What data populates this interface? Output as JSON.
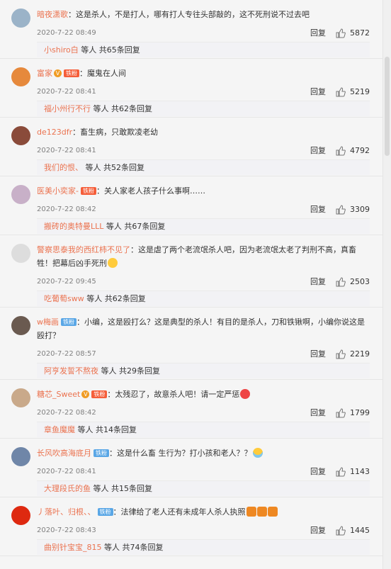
{
  "comments": [
    {
      "user": "暗夜潇歌",
      "badges": [],
      "text": "这是杀人，不是打人，哪有打人专往头部敲的，这不死刑说不过去吧",
      "emoji": "",
      "time": "2020-7-22 08:49",
      "reply": "回复",
      "likes": "5872",
      "sub_user": "小shiro白",
      "sub_more": "等人 共65条回复",
      "avatar_color": "#9bb3c8"
    },
    {
      "user": "富家",
      "badges": [
        {
          "kind": "v",
          "text": "V"
        },
        {
          "kind": "mem",
          "text": "铁粉"
        }
      ],
      "text": "魔鬼在人间",
      "emoji": "",
      "time": "2020-7-22 08:41",
      "reply": "回复",
      "likes": "5219",
      "sub_user": "福小州行不行",
      "sub_more": "等人 共62条回复",
      "avatar_color": "#e6893c"
    },
    {
      "user": "de123dfr",
      "badges": [],
      "text": "畜生病，只敢欺凌老幼",
      "emoji": "",
      "time": "2020-7-22 08:41",
      "reply": "回复",
      "likes": "4792",
      "sub_user": "我们的恨、",
      "sub_more": "等人 共52条回复",
      "avatar_color": "#8a4b3a"
    },
    {
      "user": "医美小奕家-",
      "badges": [
        {
          "kind": "mem",
          "text": "铁粉"
        }
      ],
      "text": "关人家老人孩子什么事啊……",
      "emoji": "",
      "time": "2020-7-22 08:42",
      "reply": "回复",
      "likes": "3309",
      "sub_user": "搬砖的奥特曼LLL",
      "sub_more": "等人 共67条回复",
      "avatar_color": "#c8b0c8"
    },
    {
      "user": "警察思泰我的西红柿不见了",
      "badges": [],
      "text": "这是虐了两个老流氓杀人吧，因为老流氓太老了判刑不高，真畜牲！把幕后凶手死刑",
      "emoji": "smile",
      "time": "2020-7-22 09:45",
      "reply": "回复",
      "likes": "2503",
      "sub_user": "吃葡萄sww",
      "sub_more": "等人 共62条回复",
      "avatar_color": "#dddddd",
      "tall": true
    },
    {
      "user": "w梅画",
      "badges": [
        {
          "kind": "fan",
          "text": "铁粉"
        }
      ],
      "text": "小编，这是殴打么？这是典型的杀人！有目的是杀人，刀和铁锹啊，小编你说这是殴打？",
      "emoji": "",
      "time": "2020-7-22 08:57",
      "reply": "回复",
      "likes": "2219",
      "sub_user": "阿亨发誓不熬夜",
      "sub_more": "等人 共29条回复",
      "avatar_color": "#6a5a50",
      "tall": true
    },
    {
      "user": "糖芯_Sweet",
      "badges": [
        {
          "kind": "v",
          "text": "V"
        },
        {
          "kind": "mem",
          "text": "铁粉"
        }
      ],
      "text": "太残忍了，故意杀人吧！请一定严惩",
      "emoji": "angry",
      "time": "2020-7-22 08:42",
      "reply": "回复",
      "likes": "1799",
      "sub_user": "章鱼魔魔",
      "sub_more": "等人 共14条回复",
      "avatar_color": "#c9a98a"
    },
    {
      "user": "长风吹高海底月",
      "badges": [
        {
          "kind": "fan",
          "text": "铁粉"
        }
      ],
      "text": "这是什么畜 生行为？打小孩和老人？？",
      "emoji": "cry",
      "time": "2020-7-22 08:41",
      "reply": "回复",
      "likes": "1143",
      "sub_user": "大理段氏的鱼",
      "sub_more": "等人 共15条回复",
      "avatar_color": "#6f86a8"
    },
    {
      "user": "丿落叶、归根、、",
      "badges": [
        {
          "kind": "fan",
          "text": "铁粉"
        }
      ],
      "text": "法律给了老人还有未成年人杀人执照",
      "emoji": "candle",
      "emoji_count": 3,
      "time": "2020-7-22 08:43",
      "reply": "回复",
      "likes": "1445",
      "sub_user": "曲别针宝宝_815",
      "sub_more": "等人 共74条回复",
      "avatar_color": "#de2910"
    }
  ],
  "icons": {
    "like": "thumbs-up-icon"
  }
}
